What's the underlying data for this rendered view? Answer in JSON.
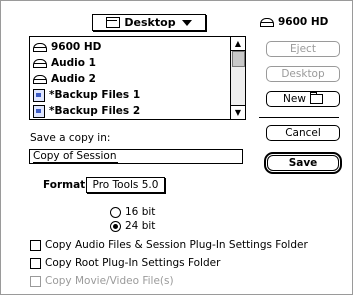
{
  "location_popup": {
    "label": "Desktop",
    "icon": "folder-icon"
  },
  "file_list": {
    "items": [
      {
        "label": "9600 HD",
        "icon": "disk-icon"
      },
      {
        "label": "Audio 1",
        "icon": "disk-icon"
      },
      {
        "label": "Audio 2",
        "icon": "disk-icon"
      },
      {
        "label": "*Backup Files 1",
        "icon": "backup-folder-icon"
      },
      {
        "label": "*Backup Files 2",
        "icon": "backup-folder-icon"
      }
    ]
  },
  "volume": {
    "label": "9600 HD",
    "icon": "disk-icon"
  },
  "buttons": {
    "eject": "Eject",
    "desktop": "Desktop",
    "new": "New",
    "cancel": "Cancel",
    "save": "Save"
  },
  "save_copy": {
    "label": "Save a copy in:",
    "value": "Copy of Session"
  },
  "format": {
    "label": "Format:",
    "value": "Pro Tools 5.0"
  },
  "bit_depth": {
    "options": [
      "16 bit",
      "24 bit"
    ],
    "selected": "24 bit"
  },
  "checkboxes": [
    {
      "label": "Copy Audio Files & Session Plug-In Settings Folder",
      "checked": false,
      "enabled": true
    },
    {
      "label": "Copy Root Plug-In Settings Folder",
      "checked": false,
      "enabled": true
    },
    {
      "label": "Copy Movie/Video File(s)",
      "checked": false,
      "enabled": false
    }
  ]
}
